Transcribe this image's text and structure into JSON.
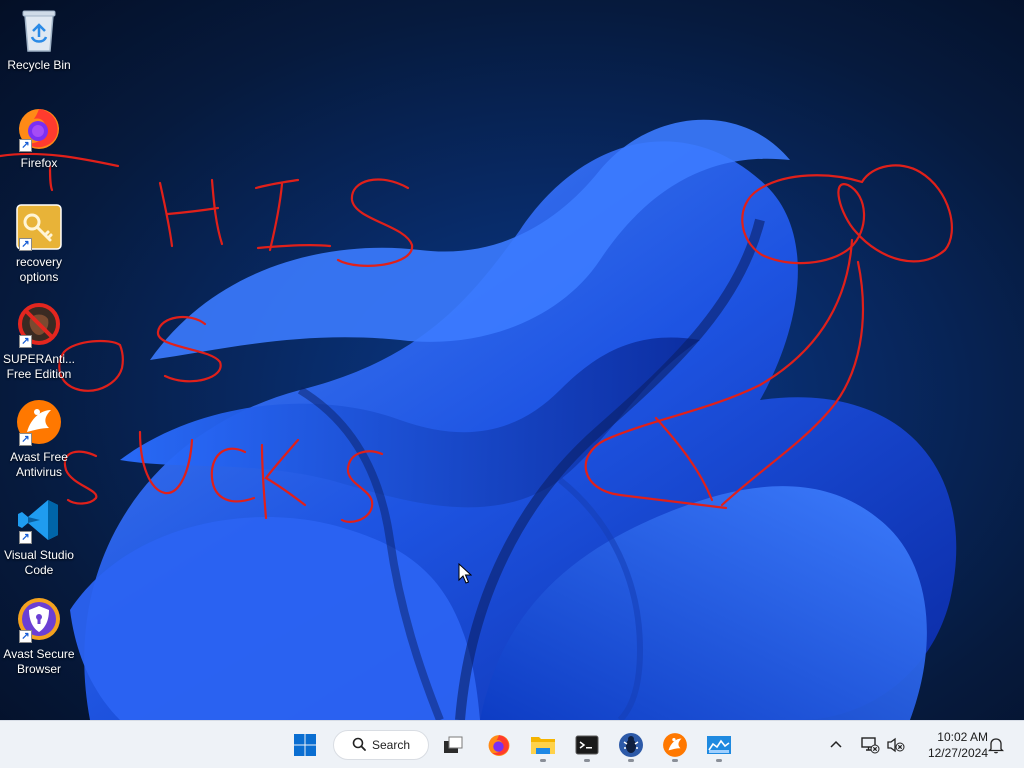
{
  "desktop": {
    "icons": [
      {
        "label": "Recycle Bin",
        "icon": "recycle-bin-icon"
      },
      {
        "label": "Firefox",
        "icon": "firefox-icon"
      },
      {
        "label": "recovery options",
        "icon": "key-icon"
      },
      {
        "label": "SUPERAnti... Free Edition",
        "icon": "superantispyware-icon"
      },
      {
        "label": "Avast Free Antivirus",
        "icon": "avast-icon"
      },
      {
        "label": "Visual Studio Code",
        "icon": "vscode-icon"
      },
      {
        "label": "Avast Secure Browser",
        "icon": "avast-secure-browser-icon"
      }
    ],
    "scribble_color": "#e0201a"
  },
  "taskbar": {
    "search_label": "Search",
    "apps": [
      {
        "name": "start-button",
        "icon": "windows-logo-icon"
      },
      {
        "name": "search",
        "icon": "search-icon"
      },
      {
        "name": "task-view",
        "icon": "task-view-icon"
      },
      {
        "name": "firefox",
        "icon": "firefox-icon"
      },
      {
        "name": "file-explorer",
        "icon": "folder-icon"
      },
      {
        "name": "terminal",
        "icon": "terminal-icon"
      },
      {
        "name": "bug-app",
        "icon": "bug-icon"
      },
      {
        "name": "avast",
        "icon": "avast-icon"
      },
      {
        "name": "monitor-app",
        "icon": "chart-monitor-icon"
      }
    ],
    "clock": {
      "time": "10:02 AM",
      "date": "12/27/2024"
    }
  },
  "colors": {
    "taskbar_bg": "#eef2f7",
    "wallpaper_accent": "#1f56e8",
    "windows_blue": "#0a6ed1"
  }
}
